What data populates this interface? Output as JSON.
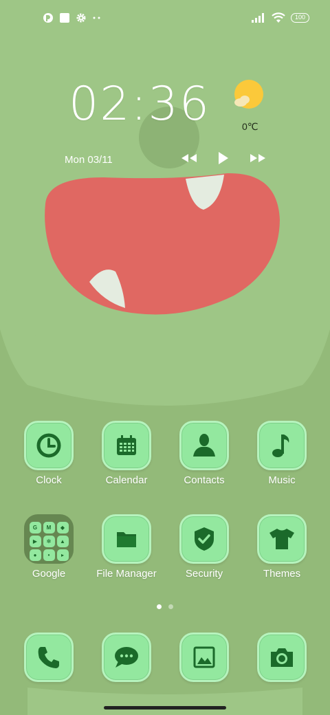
{
  "status_bar": {
    "battery": "100",
    "notification_icons": [
      "notification-app-icon",
      "square-icon",
      "gear-icon",
      "more-dots-icon"
    ],
    "system_icons": [
      "signal-icon",
      "wifi-icon",
      "battery-icon"
    ]
  },
  "widget": {
    "time": "02:36",
    "temperature": "0℃",
    "weather_icon": "partly-sunny-icon",
    "date": "Mon 03/11",
    "media_controls": [
      "previous-icon",
      "play-icon",
      "next-icon"
    ]
  },
  "apps": [
    {
      "label": "Clock",
      "icon": "clock-icon"
    },
    {
      "label": "Calendar",
      "icon": "calendar-icon"
    },
    {
      "label": "Contacts",
      "icon": "contacts-icon"
    },
    {
      "label": "Music",
      "icon": "music-note-icon"
    },
    {
      "label": "Google",
      "icon": "folder",
      "folder_items": [
        "G",
        "M",
        "Maps",
        "YouTube",
        "Photos",
        "Drive",
        "Duo",
        "Assistant",
        "Play"
      ]
    },
    {
      "label": "File Manager",
      "icon": "folder-icon"
    },
    {
      "label": "Security",
      "icon": "shield-check-icon"
    },
    {
      "label": "Themes",
      "icon": "tshirt-icon"
    }
  ],
  "pages": {
    "count": 2,
    "current": 1
  },
  "dock": [
    {
      "icon": "phone-icon"
    },
    {
      "icon": "messages-icon"
    },
    {
      "icon": "gallery-icon"
    },
    {
      "icon": "camera-icon"
    }
  ],
  "colors": {
    "wallpaper": "#9ec686",
    "face": "#94bc7a",
    "mouth": "#e06862",
    "tooth": "#e4ece0",
    "tile": "#93e89f",
    "icon": "#1b6a2a",
    "weather_sun": "#fbc93a"
  }
}
